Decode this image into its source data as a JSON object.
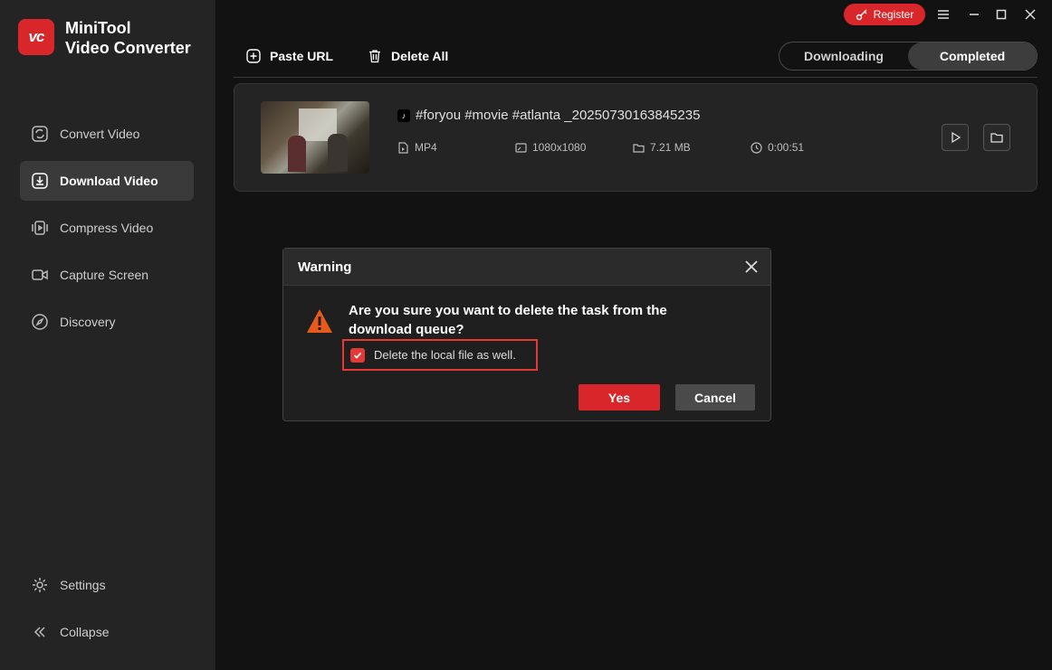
{
  "app": {
    "name_line1": "MiniTool",
    "name_line2": "Video Converter",
    "logo_text": "vc"
  },
  "sidebar": {
    "items": [
      {
        "label": "Convert Video",
        "icon": "convert-icon",
        "active": false
      },
      {
        "label": "Download Video",
        "icon": "download-icon",
        "active": true
      },
      {
        "label": "Compress Video",
        "icon": "compress-icon",
        "active": false
      },
      {
        "label": "Capture Screen",
        "icon": "camera-icon",
        "active": false
      },
      {
        "label": "Discovery",
        "icon": "compass-icon",
        "active": false
      }
    ],
    "bottom": {
      "settings": "Settings",
      "collapse": "Collapse"
    }
  },
  "topbar": {
    "register": "Register"
  },
  "toolbar": {
    "paste_url": "Paste URL",
    "delete_all": "Delete All"
  },
  "tabs": [
    {
      "label": "Downloading"
    },
    {
      "label": "Completed"
    }
  ],
  "task": {
    "title": "#foryou #movie #atlanta _20250730163845235",
    "format": "MP4",
    "resolution": "1080x1080",
    "size": "7.21 MB",
    "duration": "0:00:51"
  },
  "dialog": {
    "title": "Warning",
    "message": "Are you sure you want to delete the task from the download queue?",
    "checkbox_label": "Delete the local file as well.",
    "checkbox_checked": true,
    "yes": "Yes",
    "cancel": "Cancel"
  },
  "colors": {
    "accent": "#d9262a",
    "sidebar_bg": "#242424",
    "main_bg": "#121212"
  }
}
